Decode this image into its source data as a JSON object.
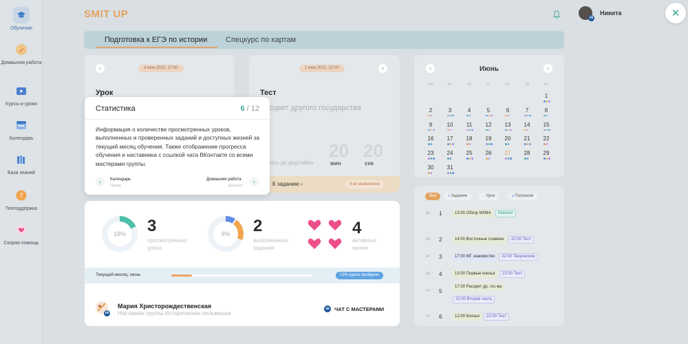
{
  "app": {
    "logo": "SMIT UP"
  },
  "sidebar": {
    "items": [
      {
        "label": "Обучение",
        "icon": "graduation-cap-icon"
      },
      {
        "label": "Домашняя работа",
        "icon": "pencil-icon"
      },
      {
        "label": "Курсы и уроки",
        "icon": "video-icon"
      },
      {
        "label": "Календарь",
        "icon": "calendar-icon"
      },
      {
        "label": "База знаний",
        "icon": "books-icon"
      },
      {
        "label": "Техподдержка",
        "icon": "question-icon"
      },
      {
        "label": "Скорая помощь",
        "icon": "heart-icon"
      }
    ]
  },
  "user": {
    "name": "Никита"
  },
  "tabs": [
    "Подготовка к ЕГЭ по истории",
    "Спецкурс по картам"
  ],
  "lesson_card": {
    "date": "4 июн 2022, 17:00",
    "title": "Урок"
  },
  "test_card": {
    "date": "1 июн 2022, 22:00",
    "title": "Тест",
    "subtitle": "Расцвет другого государства",
    "deadline_label": "Осталось до дедлайна",
    "min_value": "20",
    "min_label": "мин",
    "sec_value": "20",
    "sec_label": "сек",
    "task_link": "К заданию",
    "status": "3 не выполнено"
  },
  "popup": {
    "title": "Статистика",
    "count_current": "6",
    "count_sep": "/",
    "count_total": "12",
    "text": "Информация о количестве просмотренных уроков, выполненных и проверенных заданий и доступных жизней за текущий месяц обучения. Также отображение прогресса обучения и наставника с ссылкой чата ВКонтакте со всеми мастерами группы.",
    "back_label": "Календарь",
    "back_sub": "Назад",
    "next_label": "Домашняя работа",
    "next_sub": "Дальше"
  },
  "stats": {
    "lessons": {
      "percent": 18,
      "percent_label": "18%",
      "value": "3",
      "label": "просмотренных урока"
    },
    "tasks": {
      "percent": 9,
      "percent_label": "9%",
      "value": "2",
      "label": "выполненных задания"
    },
    "lives": {
      "value": "4",
      "label": "активные жизни",
      "hearts": 4
    }
  },
  "progress": {
    "month_label": "Текущий месяц: июнь",
    "fraction": 0.13,
    "badge": "13% курса пройдено"
  },
  "mentor": {
    "name": "Мария Христорождественская",
    "subtitle": "Наставник группы Исторические пельмешки",
    "chat_label": "ЧАТ С МАСТЕРАМИ"
  },
  "calendar": {
    "month": "Июнь",
    "weekdays": [
      "пн",
      "вт",
      "ср",
      "чт",
      "пт",
      "сб",
      "вс"
    ],
    "weeks": [
      [
        "",
        "",
        "",
        "",
        "",
        "",
        "1"
      ],
      [
        "2",
        "3",
        "4",
        "5",
        "6",
        "7",
        "8"
      ],
      [
        "9",
        "10",
        "11",
        "12",
        "13",
        "14",
        "15"
      ],
      [
        "16",
        "17",
        "18",
        "19",
        "20",
        "21",
        "22"
      ],
      [
        "23",
        "24",
        "25",
        "26",
        "27",
        "28",
        "29"
      ],
      [
        "30",
        "31",
        "",
        "",
        "",
        "",
        ""
      ]
    ],
    "highlight_day": "27"
  },
  "schedule": {
    "filters": [
      "Все",
      "Задание",
      "Урок",
      "Полезное"
    ],
    "days": [
      {
        "name": "вс",
        "num": "1",
        "events": [
          {
            "text": "13:00 Обзор КИМА",
            "style": "a"
          },
          {
            "text": "Квизлет",
            "style": "c"
          }
        ]
      },
      {
        "name": "пн",
        "num": "2",
        "events": [
          {
            "text": "14:00 Восточные славяне",
            "style": "a"
          },
          {
            "text": "22:00 Тест",
            "style": "b"
          }
        ]
      },
      {
        "name": "вт",
        "num": "3",
        "events": [
          {
            "text": "17:00 МГ знакомство",
            "style": "d"
          },
          {
            "text": "22:00 Творческое",
            "style": "b"
          }
        ]
      },
      {
        "name": "ср",
        "num": "4",
        "events": [
          {
            "text": "13:00 Первые князья",
            "style": "a"
          },
          {
            "text": "22:00 Тест",
            "style": "b"
          }
        ]
      },
      {
        "name": "чт",
        "num": "5",
        "events": [
          {
            "text": "17:00 Расцвет др. гос-ва",
            "style": "a"
          },
          {
            "text": "22:00 Вторая часть",
            "style": "b"
          }
        ]
      },
      {
        "name": "пт",
        "num": "6",
        "events": [
          {
            "text": "12:00 Князья",
            "style": "a"
          },
          {
            "text": "22:00 Тест",
            "style": "b"
          }
        ]
      }
    ]
  },
  "colors": {
    "accent": "#4aa89e",
    "orange": "#e3a35f",
    "heart": "#ec4f8a",
    "ring_green": "#4dbfa7",
    "ring_blue": "#5f8ee6"
  }
}
